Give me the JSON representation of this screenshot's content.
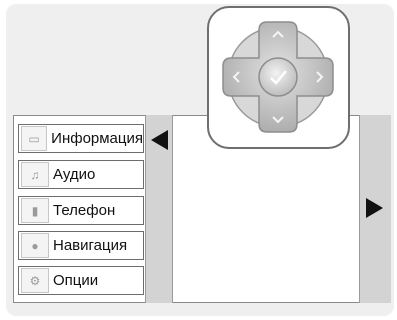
{
  "menu": {
    "items": [
      {
        "label": "Информация",
        "icon": "car-icon",
        "glyph": "▭"
      },
      {
        "label": "Аудио",
        "icon": "music-note-icon",
        "glyph": "♫"
      },
      {
        "label": "Телефон",
        "icon": "phone-icon",
        "glyph": "▮"
      },
      {
        "label": "Навигация",
        "icon": "navigation-globe-icon",
        "glyph": "●"
      },
      {
        "label": "Опции",
        "icon": "settings-gear-icon",
        "glyph": "⚙"
      }
    ]
  },
  "controller": {
    "icons": [
      "chevron-up-icon",
      "chevron-down-icon",
      "chevron-left-icon",
      "chevron-right-icon",
      "checkmark-icon"
    ]
  },
  "colors": {
    "background": "#efefef",
    "column": "#d3d3d3",
    "controller_body": "#bfbfbf",
    "arrow": "#111111"
  }
}
